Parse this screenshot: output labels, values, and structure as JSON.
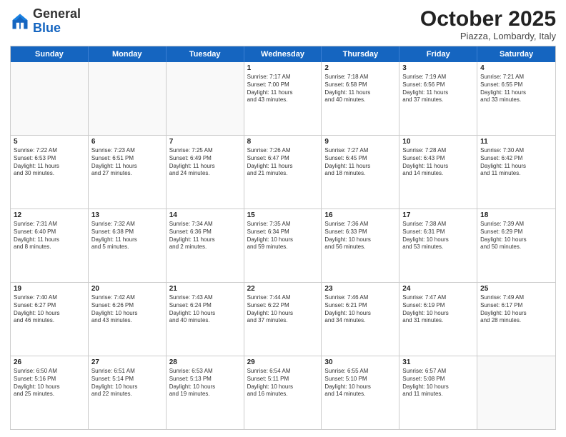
{
  "header": {
    "logo_general": "General",
    "logo_blue": "Blue",
    "month_title": "October 2025",
    "subtitle": "Piazza, Lombardy, Italy"
  },
  "days_of_week": [
    "Sunday",
    "Monday",
    "Tuesday",
    "Wednesday",
    "Thursday",
    "Friday",
    "Saturday"
  ],
  "weeks": [
    [
      {
        "day": "",
        "text": ""
      },
      {
        "day": "",
        "text": ""
      },
      {
        "day": "",
        "text": ""
      },
      {
        "day": "1",
        "text": "Sunrise: 7:17 AM\nSunset: 7:00 PM\nDaylight: 11 hours\nand 43 minutes."
      },
      {
        "day": "2",
        "text": "Sunrise: 7:18 AM\nSunset: 6:58 PM\nDaylight: 11 hours\nand 40 minutes."
      },
      {
        "day": "3",
        "text": "Sunrise: 7:19 AM\nSunset: 6:56 PM\nDaylight: 11 hours\nand 37 minutes."
      },
      {
        "day": "4",
        "text": "Sunrise: 7:21 AM\nSunset: 6:55 PM\nDaylight: 11 hours\nand 33 minutes."
      }
    ],
    [
      {
        "day": "5",
        "text": "Sunrise: 7:22 AM\nSunset: 6:53 PM\nDaylight: 11 hours\nand 30 minutes."
      },
      {
        "day": "6",
        "text": "Sunrise: 7:23 AM\nSunset: 6:51 PM\nDaylight: 11 hours\nand 27 minutes."
      },
      {
        "day": "7",
        "text": "Sunrise: 7:25 AM\nSunset: 6:49 PM\nDaylight: 11 hours\nand 24 minutes."
      },
      {
        "day": "8",
        "text": "Sunrise: 7:26 AM\nSunset: 6:47 PM\nDaylight: 11 hours\nand 21 minutes."
      },
      {
        "day": "9",
        "text": "Sunrise: 7:27 AM\nSunset: 6:45 PM\nDaylight: 11 hours\nand 18 minutes."
      },
      {
        "day": "10",
        "text": "Sunrise: 7:28 AM\nSunset: 6:43 PM\nDaylight: 11 hours\nand 14 minutes."
      },
      {
        "day": "11",
        "text": "Sunrise: 7:30 AM\nSunset: 6:42 PM\nDaylight: 11 hours\nand 11 minutes."
      }
    ],
    [
      {
        "day": "12",
        "text": "Sunrise: 7:31 AM\nSunset: 6:40 PM\nDaylight: 11 hours\nand 8 minutes."
      },
      {
        "day": "13",
        "text": "Sunrise: 7:32 AM\nSunset: 6:38 PM\nDaylight: 11 hours\nand 5 minutes."
      },
      {
        "day": "14",
        "text": "Sunrise: 7:34 AM\nSunset: 6:36 PM\nDaylight: 11 hours\nand 2 minutes."
      },
      {
        "day": "15",
        "text": "Sunrise: 7:35 AM\nSunset: 6:34 PM\nDaylight: 10 hours\nand 59 minutes."
      },
      {
        "day": "16",
        "text": "Sunrise: 7:36 AM\nSunset: 6:33 PM\nDaylight: 10 hours\nand 56 minutes."
      },
      {
        "day": "17",
        "text": "Sunrise: 7:38 AM\nSunset: 6:31 PM\nDaylight: 10 hours\nand 53 minutes."
      },
      {
        "day": "18",
        "text": "Sunrise: 7:39 AM\nSunset: 6:29 PM\nDaylight: 10 hours\nand 50 minutes."
      }
    ],
    [
      {
        "day": "19",
        "text": "Sunrise: 7:40 AM\nSunset: 6:27 PM\nDaylight: 10 hours\nand 46 minutes."
      },
      {
        "day": "20",
        "text": "Sunrise: 7:42 AM\nSunset: 6:26 PM\nDaylight: 10 hours\nand 43 minutes."
      },
      {
        "day": "21",
        "text": "Sunrise: 7:43 AM\nSunset: 6:24 PM\nDaylight: 10 hours\nand 40 minutes."
      },
      {
        "day": "22",
        "text": "Sunrise: 7:44 AM\nSunset: 6:22 PM\nDaylight: 10 hours\nand 37 minutes."
      },
      {
        "day": "23",
        "text": "Sunrise: 7:46 AM\nSunset: 6:21 PM\nDaylight: 10 hours\nand 34 minutes."
      },
      {
        "day": "24",
        "text": "Sunrise: 7:47 AM\nSunset: 6:19 PM\nDaylight: 10 hours\nand 31 minutes."
      },
      {
        "day": "25",
        "text": "Sunrise: 7:49 AM\nSunset: 6:17 PM\nDaylight: 10 hours\nand 28 minutes."
      }
    ],
    [
      {
        "day": "26",
        "text": "Sunrise: 6:50 AM\nSunset: 5:16 PM\nDaylight: 10 hours\nand 25 minutes."
      },
      {
        "day": "27",
        "text": "Sunrise: 6:51 AM\nSunset: 5:14 PM\nDaylight: 10 hours\nand 22 minutes."
      },
      {
        "day": "28",
        "text": "Sunrise: 6:53 AM\nSunset: 5:13 PM\nDaylight: 10 hours\nand 19 minutes."
      },
      {
        "day": "29",
        "text": "Sunrise: 6:54 AM\nSunset: 5:11 PM\nDaylight: 10 hours\nand 16 minutes."
      },
      {
        "day": "30",
        "text": "Sunrise: 6:55 AM\nSunset: 5:10 PM\nDaylight: 10 hours\nand 14 minutes."
      },
      {
        "day": "31",
        "text": "Sunrise: 6:57 AM\nSunset: 5:08 PM\nDaylight: 10 hours\nand 11 minutes."
      },
      {
        "day": "",
        "text": ""
      }
    ]
  ]
}
